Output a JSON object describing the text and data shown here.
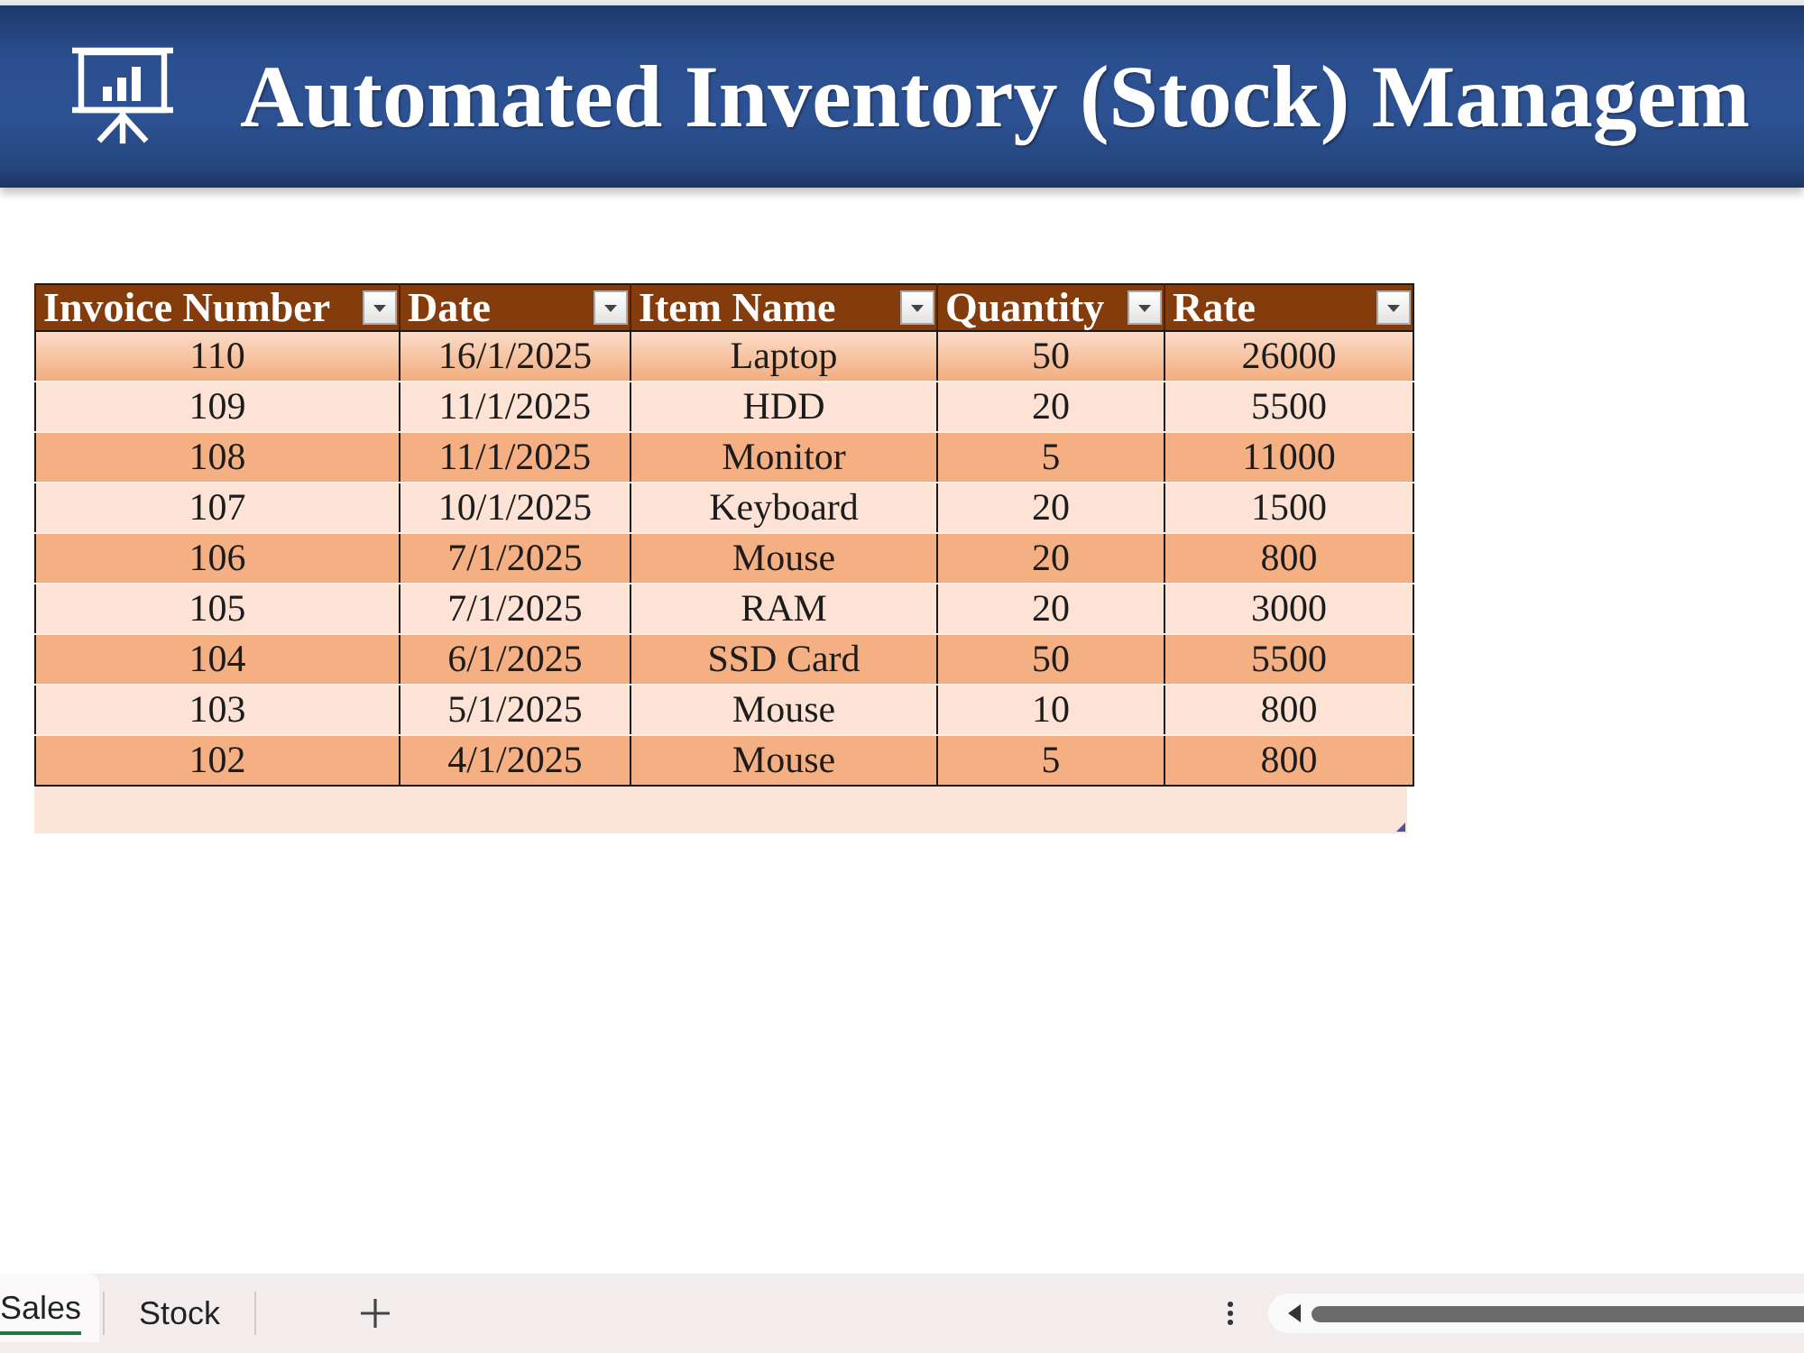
{
  "banner": {
    "title": "Automated Inventory (Stock) Managem"
  },
  "table": {
    "columns": [
      "Invoice Number",
      "Date",
      "Item Name",
      "Quantity",
      "Rate"
    ],
    "rows": [
      [
        "110",
        "16/1/2025",
        "Laptop",
        "50",
        "26000"
      ],
      [
        "109",
        "11/1/2025",
        "HDD",
        "20",
        "5500"
      ],
      [
        "108",
        "11/1/2025",
        "Monitor",
        "5",
        "11000"
      ],
      [
        "107",
        "10/1/2025",
        "Keyboard",
        "20",
        "1500"
      ],
      [
        "106",
        "7/1/2025",
        "Mouse",
        "20",
        "800"
      ],
      [
        "105",
        "7/1/2025",
        "RAM",
        "20",
        "3000"
      ],
      [
        "104",
        "6/1/2025",
        "SSD Card",
        "50",
        "5500"
      ],
      [
        "103",
        "5/1/2025",
        "Mouse",
        "10",
        "800"
      ],
      [
        "102",
        "4/1/2025",
        "Mouse",
        "5",
        "800"
      ]
    ]
  },
  "sheet_tabs": [
    {
      "label": "Sales",
      "selected": true
    },
    {
      "label": "Stock",
      "selected": false
    }
  ]
}
